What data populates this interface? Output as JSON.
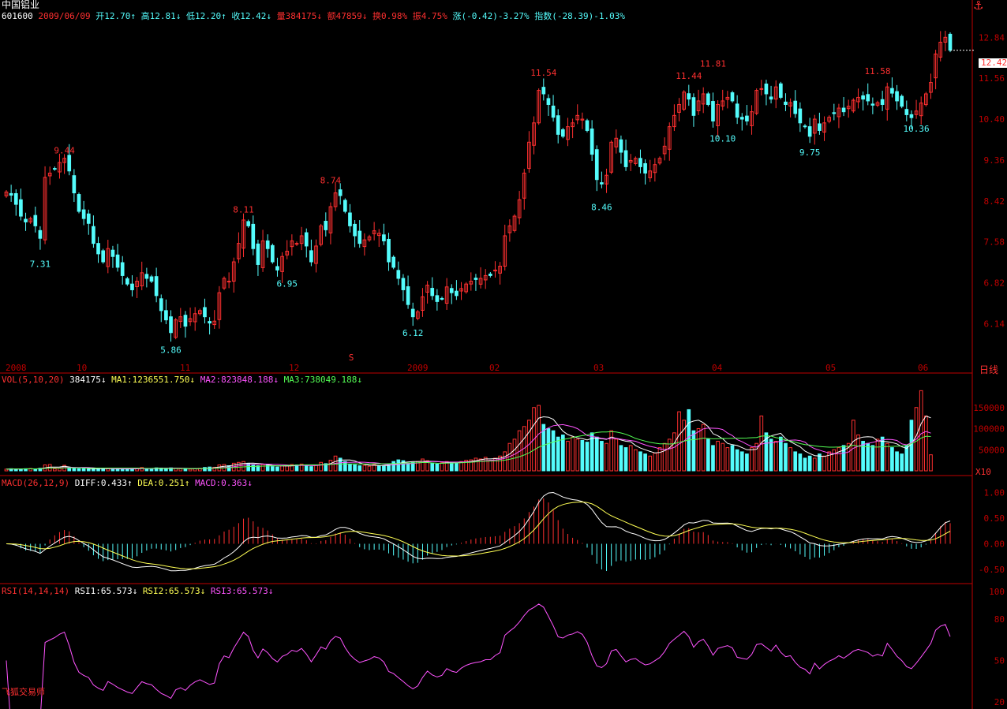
{
  "header": {
    "stock_name": "中国铝业",
    "code": "601600",
    "date": "2009/06/09",
    "fields": [
      {
        "text": "开12.70↑",
        "color": "#54fcfc"
      },
      {
        "text": "高12.81↓",
        "color": "#54fcfc"
      },
      {
        "text": "低12.20↑",
        "color": "#54fcfc"
      },
      {
        "text": "收12.42↓",
        "color": "#54fcfc"
      },
      {
        "text": "量384175↓",
        "color": "#ff3030"
      },
      {
        "text": "额47859↓",
        "color": "#ff3030"
      },
      {
        "text": "换0.98%",
        "color": "#ff3030"
      },
      {
        "text": "振4.75%",
        "color": "#ff3030"
      },
      {
        "text": "涨(-0.42)-3.27%",
        "color": "#54fcfc"
      },
      {
        "text": "指数(-28.39)-1.03%",
        "color": "#54fcfc"
      }
    ],
    "anchor_icon": "anchor-icon"
  },
  "colors": {
    "up": "#ff3030",
    "down": "#54fcfc",
    "axis": "#c00000",
    "ma1": "#ffffff",
    "ma2": "#ff54ff",
    "ma3": "#54ff54",
    "diff": "#ffffff",
    "dea": "#ffff54",
    "rsi": "#ff54ff"
  },
  "price_panel": {
    "y_ticks": [
      "12.84",
      "11.56",
      "10.40",
      "9.36",
      "8.42",
      "7.58",
      "6.82",
      "6.14"
    ],
    "current_price": "12.42",
    "x_labels": [
      "2008",
      "10",
      "11",
      "12",
      "2009",
      "02",
      "03",
      "04",
      "05",
      "06"
    ],
    "period_label": "日线",
    "marker": "S",
    "high_labels": [
      "9.44",
      "8.11",
      "8.74",
      "11.54",
      "11.44",
      "11.81",
      "11.58"
    ],
    "low_labels": [
      "7.31",
      "5.86",
      "6.95",
      "6.12",
      "8.46",
      "10.10",
      "9.75",
      "10.36"
    ]
  },
  "vol_panel": {
    "title": "VOL(5,10,20)",
    "fields": [
      {
        "text": "384175↓",
        "color": "#ffffff"
      },
      {
        "text": "MA1:1236551.750↓",
        "color": "#ffff54"
      },
      {
        "text": "MA2:823848.188↓",
        "color": "#ff54ff"
      },
      {
        "text": "MA3:738049.188↓",
        "color": "#54ff54"
      }
    ],
    "y_ticks": [
      "150000",
      "100000",
      "50000"
    ],
    "unit": "X10"
  },
  "macd_panel": {
    "title": "MACD(26,12,9)",
    "fields": [
      {
        "text": "DIFF:0.433↑",
        "color": "#ffffff"
      },
      {
        "text": "DEA:0.251↑",
        "color": "#ffff54"
      },
      {
        "text": "MACD:0.363↓",
        "color": "#ff54ff"
      }
    ],
    "y_ticks": [
      "1.00",
      "0.50",
      "0.00",
      "-0.50"
    ]
  },
  "rsi_panel": {
    "title": "RSI(14,14,14)",
    "fields": [
      {
        "text": "RSI1:65.573↓",
        "color": "#ffffff"
      },
      {
        "text": "RSI2:65.573↓",
        "color": "#ffff54"
      },
      {
        "text": "RSI3:65.573↓",
        "color": "#ff54ff"
      }
    ],
    "y_ticks": [
      "100",
      "80",
      "50",
      "20"
    ]
  },
  "footer": {
    "app_name": "飞狐交易师"
  },
  "chart_data": {
    "type": "candlestick",
    "title": "中国铝业 601600",
    "period": "daily",
    "close": [
      8.62,
      8.55,
      8.35,
      8.1,
      7.98,
      8.05,
      7.9,
      7.65,
      8.95,
      9.05,
      9.15,
      9.3,
      9.4,
      9.1,
      8.6,
      8.2,
      8.05,
      7.95,
      7.55,
      7.35,
      7.2,
      7.45,
      7.3,
      7.1,
      6.95,
      6.8,
      6.7,
      6.85,
      7.0,
      6.9,
      6.85,
      6.6,
      6.35,
      6.2,
      6.0,
      6.2,
      6.25,
      6.1,
      6.22,
      6.3,
      6.35,
      6.25,
      6.15,
      6.18,
      6.65,
      6.9,
      6.85,
      7.2,
      7.55,
      8.02,
      7.9,
      7.45,
      7.15,
      7.6,
      7.45,
      7.2,
      7.05,
      7.3,
      7.4,
      7.6,
      7.55,
      7.7,
      7.5,
      7.2,
      7.5,
      7.9,
      7.82,
      8.3,
      8.6,
      8.54,
      8.2,
      7.9,
      7.7,
      7.55,
      7.62,
      7.68,
      7.8,
      7.75,
      7.6,
      7.2,
      7.1,
      6.9,
      6.7,
      6.45,
      6.25,
      6.33,
      6.58,
      6.78,
      6.6,
      6.5,
      6.55,
      6.75,
      6.65,
      6.6,
      6.72,
      6.8,
      6.85,
      6.88,
      6.9,
      6.95,
      6.95,
      7.05,
      7.12,
      7.7,
      7.9,
      8.1,
      8.45,
      9.05,
      9.8,
      10.3,
      11.2,
      11.1,
      10.8,
      10.45,
      10.0,
      9.95,
      10.2,
      10.3,
      10.5,
      10.4,
      10.1,
      9.5,
      8.9,
      8.8,
      9.0,
      9.8,
      9.9,
      9.55,
      9.2,
      9.35,
      9.4,
      9.2,
      9.05,
      9.1,
      9.25,
      9.4,
      9.7,
      10.2,
      10.5,
      10.8,
      11.15,
      10.95,
      10.5,
      10.9,
      11.1,
      10.8,
      10.35,
      10.8,
      10.9,
      11.0,
      10.9,
      10.45,
      10.4,
      10.35,
      10.6,
      11.2,
      11.25,
      11.1,
      10.95,
      11.3,
      11.0,
      10.8,
      10.85,
      10.55,
      10.3,
      10.2,
      9.95,
      10.4,
      10.1,
      10.3,
      10.45,
      10.55,
      10.7,
      10.6,
      10.75,
      10.92,
      11.0,
      10.95,
      10.9,
      10.78,
      10.85,
      10.8,
      11.3,
      11.12,
      10.9,
      10.75,
      10.52,
      10.44,
      10.62,
      10.84,
      11.1,
      11.43,
      12.3,
      12.68,
      12.84,
      12.42
    ],
    "volume_x10": [
      4000,
      5000,
      4500,
      4500,
      5000,
      5500,
      4000,
      6000,
      14000,
      15000,
      5000,
      6000,
      13000,
      7000,
      6000,
      5000,
      5000,
      4000,
      6000,
      5500,
      4500,
      5000,
      4500,
      5000,
      4500,
      5000,
      4000,
      6000,
      8000,
      5500,
      5000,
      7000,
      6500,
      6000,
      7000,
      5500,
      5000,
      5000,
      4000,
      5000,
      6000,
      8000,
      9000,
      8500,
      14000,
      15000,
      12000,
      18000,
      20000,
      22000,
      18000,
      14000,
      12000,
      15000,
      13000,
      10000,
      9000,
      12000,
      13000,
      15000,
      14000,
      16000,
      12000,
      10000,
      14000,
      20000,
      17000,
      25000,
      35000,
      30000,
      22000,
      16000,
      14000,
      12000,
      13000,
      11000,
      15000,
      12000,
      11000,
      16000,
      22000,
      26000,
      24000,
      18000,
      20000,
      22000,
      28000,
      24000,
      18000,
      16000,
      19000,
      22000,
      20000,
      18000,
      22000,
      25000,
      26000,
      30000,
      28000,
      32000,
      25000,
      30000,
      35000,
      45000,
      65000,
      75000,
      95000,
      105000,
      120000,
      150000,
      155000,
      110000,
      100000,
      95000,
      80000,
      85000,
      70000,
      80000,
      75000,
      72000,
      68000,
      90000,
      80000,
      70000,
      65000,
      95000,
      75000,
      60000,
      55000,
      60000,
      50000,
      45000,
      40000,
      35000,
      42000,
      55000,
      65000,
      75000,
      90000,
      140000,
      120000,
      145000,
      95000,
      100000,
      110000,
      75000,
      60000,
      70000,
      65000,
      55000,
      60000,
      50000,
      45000,
      40000,
      55000,
      65000,
      130000,
      90000,
      75000,
      70000,
      80000,
      65000,
      55000,
      45000,
      40000,
      30000,
      35000,
      30000,
      40000,
      35000,
      45000,
      50000,
      55000,
      60000,
      65000,
      120000,
      85000,
      70000,
      65000,
      60000,
      75000,
      80000,
      65000,
      55000,
      45000,
      40000,
      60000,
      120000,
      150000,
      190000,
      130000,
      38000
    ],
    "vol_ylim": [
      0,
      200000
    ],
    "macd_ylim": [
      -0.7,
      1.1
    ],
    "rsi_ylim": [
      20,
      100
    ]
  }
}
